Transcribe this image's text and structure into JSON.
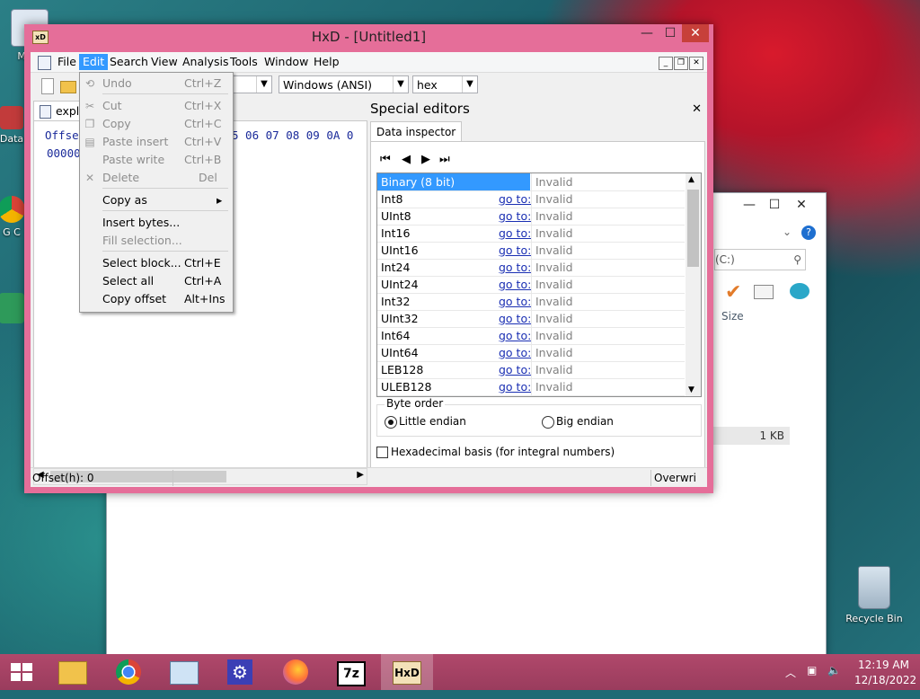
{
  "window": {
    "title": "HxD - [Untitled1]",
    "app_icon": "hxd-icon",
    "min": "—",
    "max": "☐",
    "close": "✕"
  },
  "menubar": {
    "items": [
      "File",
      "Edit",
      "Search",
      "View",
      "Analysis",
      "Tools",
      "Window",
      "Help"
    ],
    "active": "Edit"
  },
  "toolbar": {
    "charset": "Windows (ANSI)",
    "base": "hex"
  },
  "document_tab": {
    "label": "explo"
  },
  "hex_view": {
    "header_prefix": "Offse",
    "header_cols": "5 06 07 08 09 0A 0",
    "first_row_offset": "00000"
  },
  "edit_menu": {
    "items": [
      {
        "label": "Undo",
        "shortcut": "Ctrl+Z",
        "enabled": false,
        "icon": "undo-icon"
      },
      {
        "label": "Cut",
        "shortcut": "Ctrl+X",
        "enabled": false,
        "icon": "cut-icon"
      },
      {
        "label": "Copy",
        "shortcut": "Ctrl+C",
        "enabled": false,
        "icon": "copy-icon"
      },
      {
        "label": "Paste insert",
        "shortcut": "Ctrl+V",
        "enabled": false,
        "icon": "paste-icon"
      },
      {
        "label": "Paste write",
        "shortcut": "Ctrl+B",
        "enabled": false
      },
      {
        "label": "Delete",
        "shortcut": "Del",
        "enabled": false,
        "icon": "delete-icon"
      },
      {
        "label": "Copy as",
        "shortcut": "",
        "enabled": true,
        "submenu": true
      },
      {
        "label": "Insert bytes...",
        "shortcut": "",
        "enabled": true
      },
      {
        "label": "Fill selection...",
        "shortcut": "",
        "enabled": false
      },
      {
        "label": "Select block...",
        "shortcut": "Ctrl+E",
        "enabled": true
      },
      {
        "label": "Select all",
        "shortcut": "Ctrl+A",
        "enabled": true
      },
      {
        "label": "Copy offset",
        "shortcut": "Alt+Ins",
        "enabled": true
      }
    ]
  },
  "special_editors": {
    "title": "Special editors",
    "tab": "Data inspector",
    "rows": [
      {
        "name": "Binary (8 bit)",
        "goto": "",
        "value": "Invalid",
        "selected": true
      },
      {
        "name": "Int8",
        "goto": "go to:",
        "value": "Invalid"
      },
      {
        "name": "UInt8",
        "goto": "go to:",
        "value": "Invalid"
      },
      {
        "name": "Int16",
        "goto": "go to:",
        "value": "Invalid"
      },
      {
        "name": "UInt16",
        "goto": "go to:",
        "value": "Invalid"
      },
      {
        "name": "Int24",
        "goto": "go to:",
        "value": "Invalid"
      },
      {
        "name": "UInt24",
        "goto": "go to:",
        "value": "Invalid"
      },
      {
        "name": "Int32",
        "goto": "go to:",
        "value": "Invalid"
      },
      {
        "name": "UInt32",
        "goto": "go to:",
        "value": "Invalid"
      },
      {
        "name": "Int64",
        "goto": "go to:",
        "value": "Invalid"
      },
      {
        "name": "UInt64",
        "goto": "go to:",
        "value": "Invalid"
      },
      {
        "name": "LEB128",
        "goto": "go to:",
        "value": "Invalid"
      },
      {
        "name": "ULEB128",
        "goto": "go to:",
        "value": "Invalid"
      }
    ],
    "byte_order": {
      "label": "Byte order",
      "little": "Little endian",
      "big": "Big endian",
      "selected": "little"
    },
    "hex_basis": {
      "label": "Hexadecimal basis (for integral numbers)",
      "checked": false
    }
  },
  "statusbar": {
    "offset": "Offset(h): 0",
    "mode": "Overwri"
  },
  "explorer": {
    "address_fragment": "(C:)",
    "col_size": "Size",
    "file_size": "1 KB"
  },
  "desktop": {
    "icons": [
      "My C",
      "Data",
      "G C",
      "H"
    ],
    "recycle_bin": "Recycle Bin"
  },
  "taskbar": {
    "time": "12:19 AM",
    "date": "12/18/2022"
  },
  "colors": {
    "window_frame": "#e56e99",
    "taskbar": "#a8426a",
    "selection": "#3399ff"
  }
}
